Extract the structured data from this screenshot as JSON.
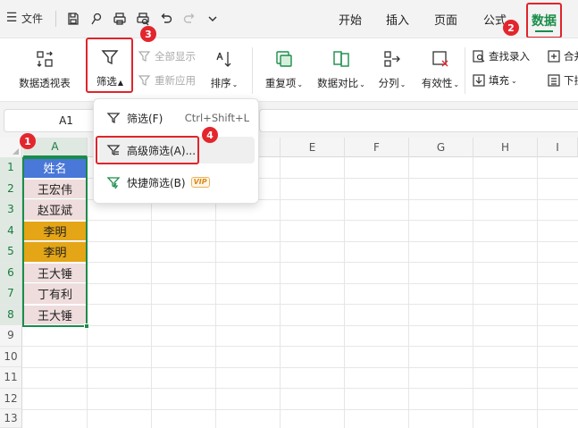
{
  "titlebar": {
    "menu_glyph": "☰",
    "file_label": "文件",
    "tabs": [
      {
        "label": "开始"
      },
      {
        "label": "插入"
      },
      {
        "label": "页面"
      },
      {
        "label": "公式"
      },
      {
        "label": "数据"
      }
    ],
    "active_tab": "数据"
  },
  "ribbon": {
    "pivot_label": "数据透视表",
    "filter_label": "筛选",
    "show_all_label": "全部显示",
    "reapply_label": "重新应用",
    "sort_label": "排序",
    "duplicates_label": "重复项",
    "compare_label": "数据对比",
    "split_label": "分列",
    "validity_label": "有效性",
    "lookup_label": "查找录入",
    "fill_label": "填充",
    "merge_label": "合并",
    "dropdown_label": "下拉"
  },
  "formula_bar": {
    "cell_ref": "A1"
  },
  "grid": {
    "columns": [
      "A",
      "B",
      "C",
      "D",
      "E",
      "F",
      "G",
      "H",
      "I"
    ],
    "rows": [
      "1",
      "2",
      "3",
      "4",
      "5",
      "6",
      "7",
      "8",
      "9",
      "10",
      "11",
      "12",
      "13"
    ],
    "column_a_cells": [
      {
        "text": "姓名",
        "bg": "#4a78d8",
        "color": "#ffffff"
      },
      {
        "text": "王宏伟",
        "bg": "#efdcdc",
        "color": "#222222"
      },
      {
        "text": "赵亚斌",
        "bg": "#efdcdc",
        "color": "#222222"
      },
      {
        "text": "李明",
        "bg": "#e4a516",
        "color": "#222222"
      },
      {
        "text": "李明",
        "bg": "#e4a516",
        "color": "#222222"
      },
      {
        "text": "王大锤",
        "bg": "#efdcdc",
        "color": "#222222"
      },
      {
        "text": "丁有利",
        "bg": "#efdcdc",
        "color": "#222222"
      },
      {
        "text": "王大锤",
        "bg": "#efdcdc",
        "color": "#222222"
      }
    ]
  },
  "dropdown": {
    "items": [
      {
        "label": "筛选(F)",
        "shortcut": "Ctrl+Shift+L"
      },
      {
        "label": "高级筛选(A)..."
      },
      {
        "label": "快捷筛选(B)",
        "badge": "VIP"
      }
    ]
  },
  "badges": [
    "1",
    "2",
    "3",
    "4"
  ],
  "colors": {
    "accent_green": "#1a8d4a",
    "annotation_red": "#e0242b"
  }
}
